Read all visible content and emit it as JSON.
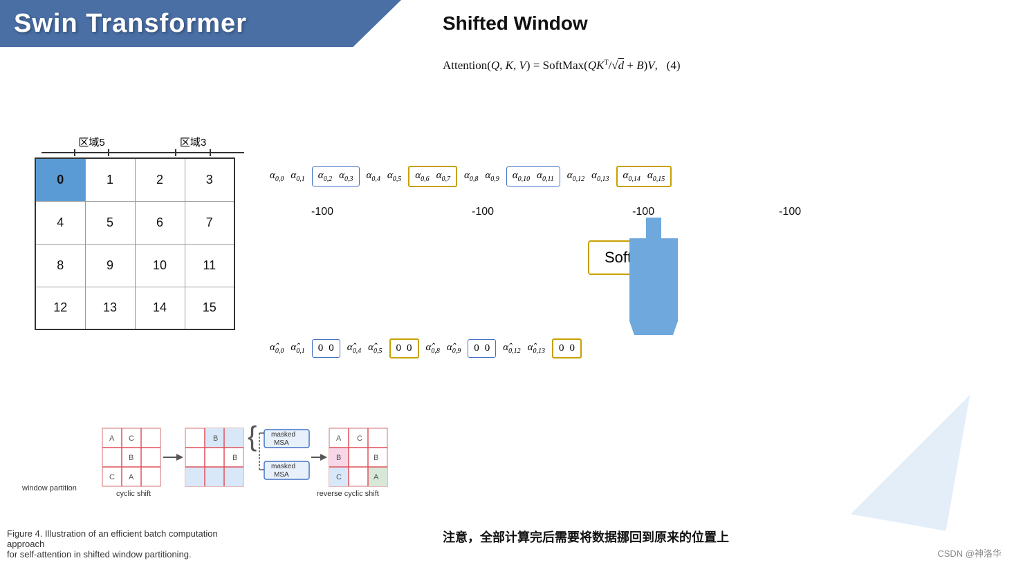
{
  "header": {
    "title": "Swin Transformer",
    "shifted_window": "Shifted Window"
  },
  "formula": {
    "text": "Attention(Q, K, V) = SoftMax(QK",
    "superscript": "T",
    "middle": "/",
    "sqrt_d": "√d",
    "plus_b": "+ B)V,",
    "number": "(4)"
  },
  "grid": {
    "label5": "区域5",
    "label3": "区域3",
    "cells": [
      [
        "0",
        "1",
        "2",
        "3"
      ],
      [
        "4",
        "5",
        "6",
        "7"
      ],
      [
        "8",
        "9",
        "10",
        "11"
      ],
      [
        "12",
        "13",
        "14",
        "15"
      ]
    ]
  },
  "attention_row": {
    "alphas": [
      {
        "id": "0,0",
        "boxed": false
      },
      {
        "id": "0,1",
        "boxed": false
      },
      {
        "id": "0,2_0,3",
        "boxed": true,
        "type": "blue",
        "values": [
          "α₀,₂",
          "α₀,₃"
        ]
      },
      {
        "id": "0,4",
        "boxed": false
      },
      {
        "id": "0,5",
        "boxed": false
      },
      {
        "id": "0,6_0,7",
        "boxed": true,
        "type": "orange",
        "values": [
          "α₀,₆",
          "α₀,₇"
        ]
      },
      {
        "id": "0,8",
        "boxed": false
      },
      {
        "id": "0,9",
        "boxed": false
      },
      {
        "id": "0,10_0,11",
        "boxed": true,
        "type": "blue",
        "values": [
          "α₀,₁₀",
          "α₀,₁₁"
        ]
      },
      {
        "id": "0,12",
        "boxed": false
      },
      {
        "id": "0,13",
        "boxed": false
      },
      {
        "id": "0,14_0,15",
        "boxed": true,
        "type": "orange",
        "values": [
          "α₀,₁₄",
          "α₀,₁₅"
        ]
      }
    ],
    "minus_values": [
      "-100",
      "-100",
      "-100",
      "-100"
    ]
  },
  "softmax": {
    "label": "Softmax"
  },
  "alpha_hat_row": {
    "items": [
      {
        "label": "α̂₀,₀",
        "boxed": false
      },
      {
        "label": "α̂₀,₁",
        "boxed": false
      },
      {
        "label": "0  0",
        "boxed": true,
        "type": "blue"
      },
      {
        "label": "α̂₀,₄",
        "boxed": false
      },
      {
        "label": "α̂₀,₅",
        "boxed": false
      },
      {
        "label": "0  0",
        "boxed": true,
        "type": "orange"
      },
      {
        "label": "α̂₀,₈",
        "boxed": false
      },
      {
        "label": "α̂₀,₉",
        "boxed": false
      },
      {
        "label": "0  0",
        "boxed": true,
        "type": "blue"
      },
      {
        "label": "α̂₀,₁₂",
        "boxed": false
      },
      {
        "label": "α̂₀,₁₃",
        "boxed": false
      },
      {
        "label": "0  0",
        "boxed": true,
        "type": "orange"
      }
    ]
  },
  "diagram": {
    "window_partition_label": "window partition",
    "cyclic_shift_label": "cyclic shift",
    "masked_msa_label1": "masked\nMSA",
    "masked_msa_label2": "masked\nMSA",
    "reverse_cyclic_shift_label": "reverse cyclic shift"
  },
  "figure_caption": {
    "line1": "Figure 4. Illustration of an efficient batch computation approach",
    "line2": "for self-attention in shifted window partitioning."
  },
  "bottom_note": "注意，全部计算完后需要将数据挪回到原来的位置上",
  "csdn_credit": "CSDN @神洛华"
}
